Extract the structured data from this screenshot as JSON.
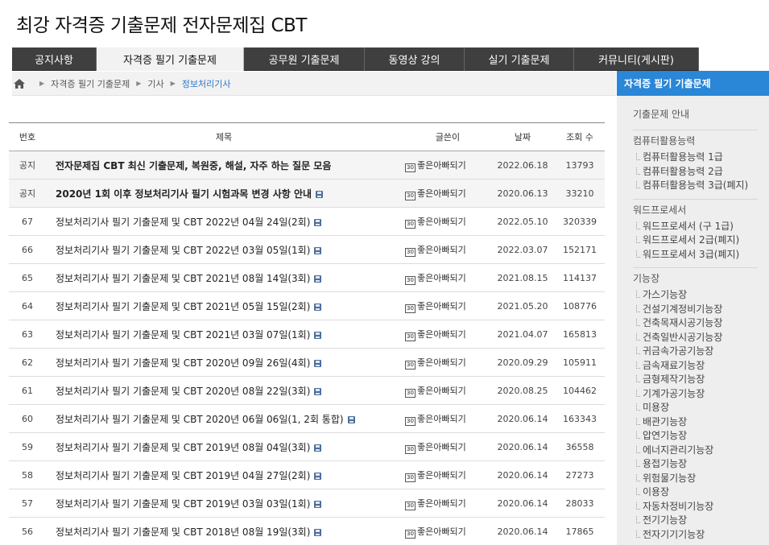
{
  "site": {
    "title": "최강 자격증 기출문제 전자문제집 CBT"
  },
  "nav": {
    "items": [
      {
        "label": "공지사항",
        "w": 105
      },
      {
        "label": "자격증 필기 기출문제",
        "w": 183,
        "active": true
      },
      {
        "label": "공무원 기출문제",
        "w": 150
      },
      {
        "label": "동영상 강의",
        "w": 124
      },
      {
        "label": "실기 기출문제",
        "w": 136
      },
      {
        "label": "커뮤니티(게시판)",
        "w": 155
      }
    ]
  },
  "breadcrumb": [
    "자격증 필기 기출문제",
    "기사",
    "정보처리기사"
  ],
  "table": {
    "headers": {
      "no": "번호",
      "title": "제목",
      "writer": "글쓴이",
      "date": "날짜",
      "views": "조회 수"
    },
    "rows": [
      {
        "no": "공지",
        "title": "전자문제집 CBT 최신 기출문제, 복원중, 해설, 자주 하는 질문 모음",
        "writer": "좋은아빠되기",
        "date": "2022.06.18",
        "views": "13793",
        "notice": true,
        "file": false
      },
      {
        "no": "공지",
        "title": "2020년 1회 이후 정보처리기사 필기 시험과목 변경 사항 안내",
        "writer": "좋은아빠되기",
        "date": "2020.06.13",
        "views": "33210",
        "notice": true,
        "file": true
      },
      {
        "no": "67",
        "title": "정보처리기사 필기 기출문제 및 CBT 2022년 04월 24일(2회)",
        "writer": "좋은아빠되기",
        "date": "2022.05.10",
        "views": "320339",
        "file": true
      },
      {
        "no": "66",
        "title": "정보처리기사 필기 기출문제 및 CBT 2022년 03월 05일(1회)",
        "writer": "좋은아빠되기",
        "date": "2022.03.07",
        "views": "152171",
        "file": true
      },
      {
        "no": "65",
        "title": "정보처리기사 필기 기출문제 및 CBT 2021년 08월 14일(3회)",
        "writer": "좋은아빠되기",
        "date": "2021.08.15",
        "views": "114137",
        "file": true
      },
      {
        "no": "64",
        "title": "정보처리기사 필기 기출문제 및 CBT 2021년 05월 15일(2회)",
        "writer": "좋은아빠되기",
        "date": "2021.05.20",
        "views": "108776",
        "file": true
      },
      {
        "no": "63",
        "title": "정보처리기사 필기 기출문제 및 CBT 2021년 03월 07일(1회)",
        "writer": "좋은아빠되기",
        "date": "2021.04.07",
        "views": "165813",
        "file": true
      },
      {
        "no": "62",
        "title": "정보처리기사 필기 기출문제 및 CBT 2020년 09월 26일(4회)",
        "writer": "좋은아빠되기",
        "date": "2020.09.29",
        "views": "105911",
        "file": true
      },
      {
        "no": "61",
        "title": "정보처리기사 필기 기출문제 및 CBT 2020년 08월 22일(3회)",
        "writer": "좋은아빠되기",
        "date": "2020.08.25",
        "views": "104462",
        "file": true
      },
      {
        "no": "60",
        "title": "정보처리기사 필기 기출문제 및 CBT 2020년 06월 06일(1, 2회 통합)",
        "writer": "좋은아빠되기",
        "date": "2020.06.14",
        "views": "163343",
        "file": true
      },
      {
        "no": "59",
        "title": "정보처리기사 필기 기출문제 및 CBT 2019년 08월 04일(3회)",
        "writer": "좋은아빠되기",
        "date": "2020.06.14",
        "views": "36558",
        "file": true
      },
      {
        "no": "58",
        "title": "정보처리기사 필기 기출문제 및 CBT 2019년 04월 27일(2회)",
        "writer": "좋은아빠되기",
        "date": "2020.06.14",
        "views": "27273",
        "file": true
      },
      {
        "no": "57",
        "title": "정보처리기사 필기 기출문제 및 CBT 2019년 03월 03일(1회)",
        "writer": "좋은아빠되기",
        "date": "2020.06.14",
        "views": "28033",
        "file": true
      },
      {
        "no": "56",
        "title": "정보처리기사 필기 기출문제 및 CBT 2018년 08월 19일(3회)",
        "writer": "좋은아빠되기",
        "date": "2020.06.14",
        "views": "17865",
        "file": true
      }
    ],
    "level_badge": "30"
  },
  "sidebar": {
    "title": "자격증 필기 기출문제",
    "guide": "기출문제 안내",
    "groups": [
      {
        "title": "컴퓨터활용능력",
        "items": [
          "컴퓨터활용능력 1급",
          "컴퓨터활용능력 2급",
          "컴퓨터활용능력 3급(폐지)"
        ]
      },
      {
        "title": "워드프로세서",
        "items": [
          "워드프로세서 (구 1급)",
          "워드프로세서 2급(폐지)",
          "워드프로세서 3급(폐지)"
        ]
      },
      {
        "title": "기능장",
        "items": [
          "가스기능장",
          "건설기계정비기능장",
          "건축목재시공기능장",
          "건축일반시공기능장",
          "귀금속가공기능장",
          "금속재료기능장",
          "금형제작기능장",
          "기계가공기능장",
          "미용장",
          "배관기능장",
          "압연기능장",
          "에너지관리기능장",
          "용접기능장",
          "위험물기능장",
          "이용장",
          "자동차정비기능장",
          "전기기능장",
          "전자기기기능장"
        ]
      }
    ]
  }
}
